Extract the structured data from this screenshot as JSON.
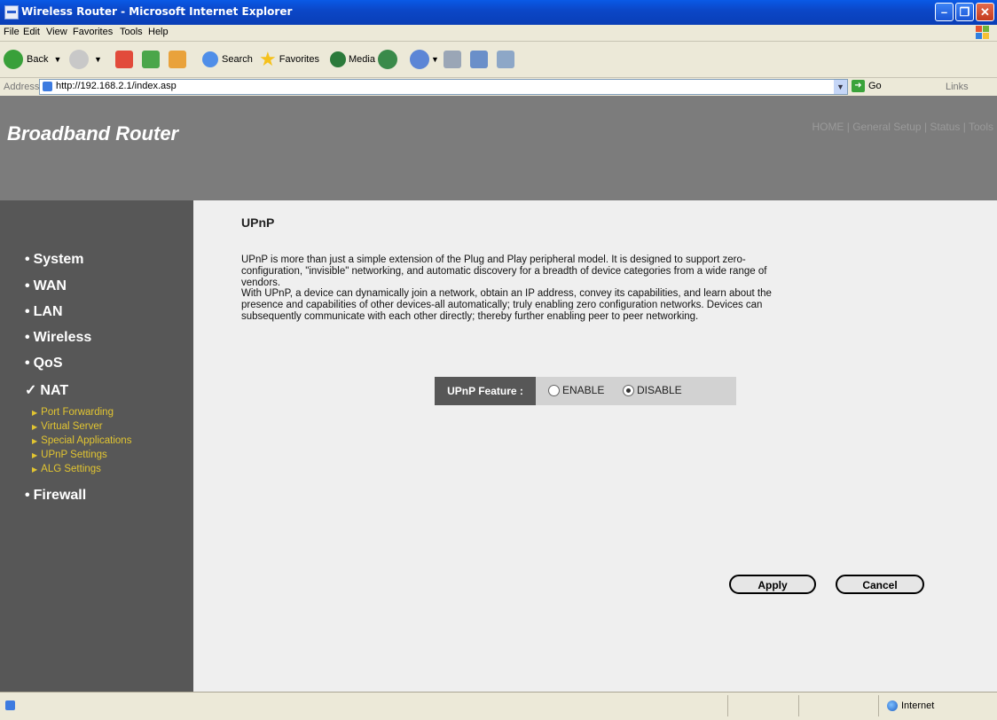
{
  "window": {
    "title": "Wireless Router - Microsoft Internet Explorer"
  },
  "menubar": {
    "items": [
      "File",
      "Edit",
      "View",
      "Favorites",
      "Tools",
      "Help"
    ]
  },
  "toolbar": {
    "back": "Back",
    "search": "Search",
    "favorites": "Favorites",
    "media": "Media"
  },
  "address": {
    "label": "Address",
    "url": "http://192.168.2.1/index.asp",
    "go": "Go",
    "links": "Links"
  },
  "header": {
    "brand": "Broadband Router",
    "topnav": "HOME | General Setup | Status | Tools"
  },
  "sidebar": {
    "items": [
      {
        "bullet": "•",
        "label": "System"
      },
      {
        "bullet": "•",
        "label": "WAN"
      },
      {
        "bullet": "•",
        "label": "LAN"
      },
      {
        "bullet": "•",
        "label": "Wireless"
      },
      {
        "bullet": "•",
        "label": "QoS"
      },
      {
        "bullet": "✓",
        "label": "NAT"
      },
      {
        "bullet": "•",
        "label": "Firewall"
      }
    ],
    "nat_sub": [
      {
        "label": "Port Forwarding"
      },
      {
        "label": "Virtual Server"
      },
      {
        "label": "Special Applications"
      },
      {
        "label": "UPnP Settings"
      },
      {
        "label": "ALG Settings"
      }
    ]
  },
  "main": {
    "title": "UPnP",
    "desc_lines": [
      "UPnP is more than just a simple extension of the Plug and Play peripheral model. It is designed to support zero-",
      "configuration, \"invisible\" networking, and automatic discovery for a breadth of device categories from a wide range of",
      "vendors.",
      "With UPnP, a device can dynamically join a network, obtain an IP address, convey its capabilities, and learn about the",
      "presence and capabilities of other devices-all automatically; truly enabling zero configuration networks. Devices can",
      "subsequently communicate with each other directly; thereby further enabling peer to peer networking."
    ],
    "feature_label": "UPnP Feature :",
    "enable_label": "ENABLE",
    "disable_label": "DISABLE",
    "selected": "DISABLE",
    "apply_label": "Apply",
    "cancel_label": "Cancel"
  },
  "statusbar": {
    "zone": "Internet"
  },
  "colors": {
    "header_bg": "#7c7c7c",
    "sidebar_bg": "#575757",
    "submenu_text": "#e2c531",
    "content_bg": "#efefef"
  }
}
